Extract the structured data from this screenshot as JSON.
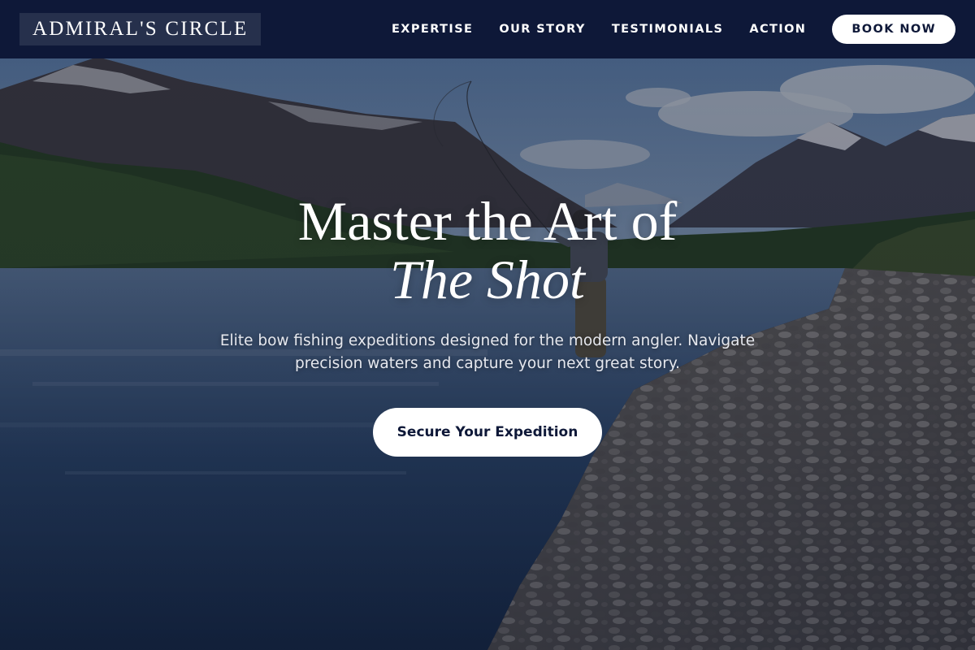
{
  "header": {
    "brand": "ADMIRAL'S CIRCLE",
    "nav": [
      {
        "label": "EXPERTISE"
      },
      {
        "label": "OUR STORY"
      },
      {
        "label": "TESTIMONIALS"
      },
      {
        "label": "ACTION"
      }
    ],
    "book_label": "BOOK NOW"
  },
  "hero": {
    "title_line1": "Master the Art of",
    "title_line2": "The Shot",
    "subtitle": "Elite bow fishing expeditions designed for the modern angler. Navigate precision waters and capture your next great story.",
    "cta_label": "Secure Your Expedition",
    "background_image": "river-fishing-landscape"
  },
  "colors": {
    "header_bg": "#0e1838",
    "brand_box": "#26304c",
    "button_bg": "#ffffff",
    "button_text": "#0e1838"
  }
}
